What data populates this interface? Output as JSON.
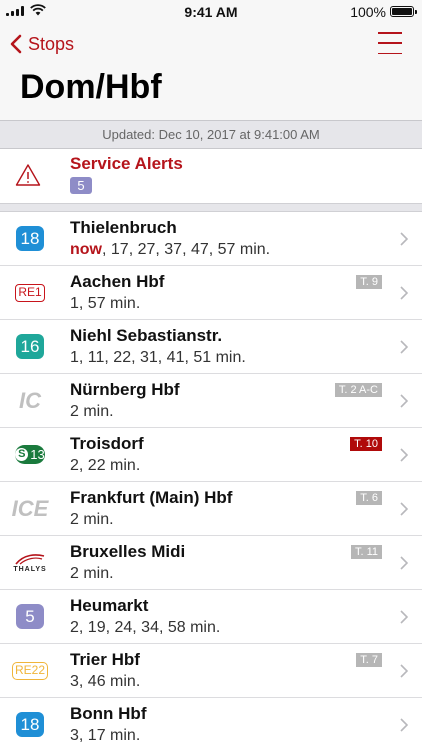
{
  "status_bar": {
    "time": "9:41 AM",
    "battery": "100%"
  },
  "nav": {
    "back_label": "Stops",
    "title": "Dom/Hbf"
  },
  "updated": "Updated: Dec 10, 2017 at 9:41:00 AM",
  "alerts": {
    "title": "Service Alerts",
    "count": "5"
  },
  "departures": [
    {
      "line": "18",
      "destination": "Thielenbruch",
      "now": "now",
      "times": ", 17, 27, 37, 47, 57 min.",
      "track": ""
    },
    {
      "line": "RE1",
      "destination": "Aachen Hbf",
      "now": "",
      "times": "1, 57 min.",
      "track": "T. 9"
    },
    {
      "line": "16",
      "destination": "Niehl Sebastianstr.",
      "now": "",
      "times": "1, 11, 22, 31, 41, 51 min.",
      "track": ""
    },
    {
      "line": "IC",
      "destination": "Nürnberg Hbf",
      "now": "",
      "times": "2 min.",
      "track": "T. 2 A-C"
    },
    {
      "line_s": "S",
      "line": "13",
      "destination": "Troisdorf",
      "now": "",
      "times": "2, 22 min.",
      "track": "T. 10"
    },
    {
      "line": "ICE",
      "destination": "Frankfurt (Main) Hbf",
      "now": "",
      "times": "2 min.",
      "track": "T. 6"
    },
    {
      "line": "THALYS",
      "destination": "Bruxelles Midi",
      "now": "",
      "times": "2 min.",
      "track": "T. 11"
    },
    {
      "line": "5",
      "destination": "Heumarkt",
      "now": "",
      "times": "2, 19, 24, 34, 58 min.",
      "track": ""
    },
    {
      "line": "RE22",
      "destination": "Trier Hbf",
      "now": "",
      "times": "3, 46 min.",
      "track": "T. 7"
    },
    {
      "line": "18",
      "destination": "Bonn Hbf",
      "now": "",
      "times": "3, 17 min.",
      "track": ""
    }
  ],
  "colors": {
    "accent": "#b5141b",
    "tram_blue": "#1f8fd6",
    "tram_teal": "#1fa79a",
    "tram_purple": "#8e8cc7",
    "sbahn_green": "#1a7a3d",
    "track_red": "#b00a0a",
    "track_gray": "#b6b6b6"
  },
  "icons": {
    "back": "chevron-left-icon",
    "menu": "hamburger-menu-icon",
    "alert": "warning-triangle-icon",
    "row": "chevron-right-icon"
  }
}
